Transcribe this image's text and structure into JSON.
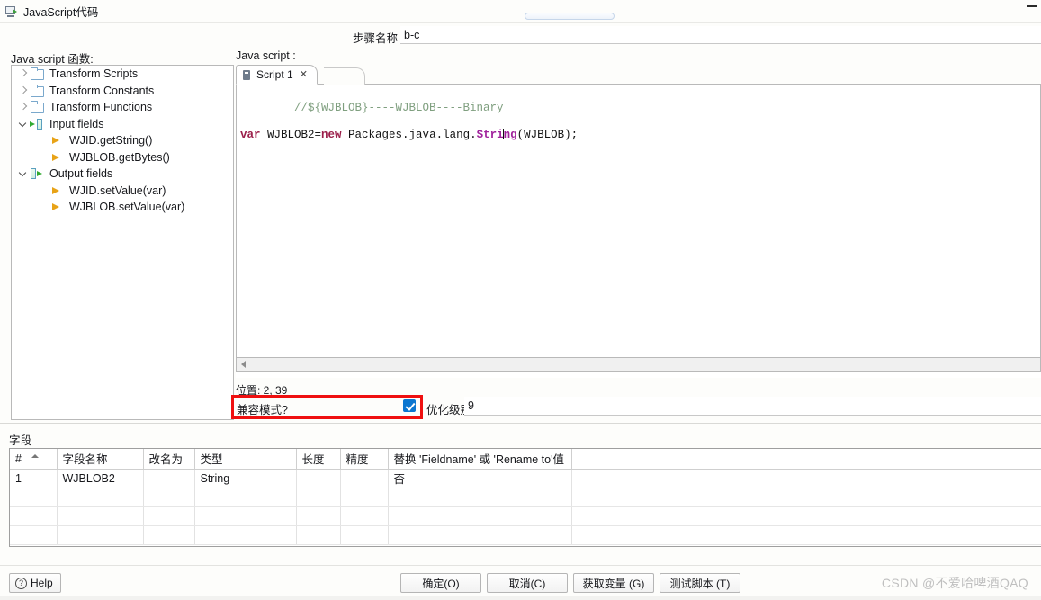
{
  "window": {
    "title": "JavaScript代码",
    "icon": "script-window-icon",
    "minimize_label": "—"
  },
  "step": {
    "label": "步骤名称",
    "value": "b-c",
    "placeholder": ""
  },
  "panels": {
    "functions_label": "Java script 函数:",
    "script_label": "Java script :"
  },
  "tree": {
    "items": [
      {
        "label": "Transform Scripts",
        "icon": "folder-icon",
        "indent": 0,
        "twisty": "collapsed"
      },
      {
        "label": "Transform Constants",
        "icon": "folder-icon",
        "indent": 0,
        "twisty": "collapsed"
      },
      {
        "label": "Transform Functions",
        "icon": "folder-icon",
        "indent": 0,
        "twisty": "collapsed"
      },
      {
        "label": "Input fields",
        "icon": "input-fields-icon",
        "indent": 0,
        "twisty": "expanded"
      },
      {
        "label": "WJID.getString()",
        "icon": "arrow-leaf-icon",
        "indent": 1,
        "twisty": "none"
      },
      {
        "label": "WJBLOB.getBytes()",
        "icon": "arrow-leaf-icon",
        "indent": 1,
        "twisty": "none"
      },
      {
        "label": "Output fields",
        "icon": "output-fields-icon",
        "indent": 0,
        "twisty": "expanded"
      },
      {
        "label": "WJID.setValue(var)",
        "icon": "arrow-leaf-icon",
        "indent": 1,
        "twisty": "none"
      },
      {
        "label": "WJBLOB.setValue(var)",
        "icon": "arrow-leaf-icon",
        "indent": 1,
        "twisty": "none"
      }
    ]
  },
  "editor": {
    "tab_label": "Script 1",
    "tab_icon": "script-tab-icon",
    "tab_close": "✕",
    "line1": {
      "comment": "//${WJBLOB}----WJBLOB----Binary"
    },
    "line2": {
      "kw_var": "var",
      "mid1": " WJBLOB2=",
      "kw_new": "new",
      "mid2": " Packages.java.lang.",
      "type_a": "Stri",
      "type_b": "ng",
      "tail": "(WJBLOB);"
    },
    "position_text": "位置: 2, 39"
  },
  "options": {
    "compat_label": "兼容模式?",
    "compat_checked": true,
    "opt_label": "优化级别",
    "opt_value": "9",
    "highlight_color": "#ef1010"
  },
  "fields": {
    "section_label": "字段",
    "columns": [
      "#",
      "字段名称",
      "改名为",
      "类型",
      "长度",
      "精度",
      "替换 'Fieldname' 或 'Rename to'值"
    ],
    "rows": [
      {
        "index": "1",
        "name": "WJBLOB2",
        "rename_to": "",
        "type": "String",
        "length": "",
        "precision": "",
        "replace": "否"
      }
    ],
    "empty_row_count": 3
  },
  "buttons": {
    "help": "Help",
    "ok": "确定(O)",
    "cancel": "取消(C)",
    "get_variables": "获取变量 (G)",
    "test_script": "测试脚本 (T)"
  },
  "watermark": "CSDN @不爱哈啤酒QAQ"
}
